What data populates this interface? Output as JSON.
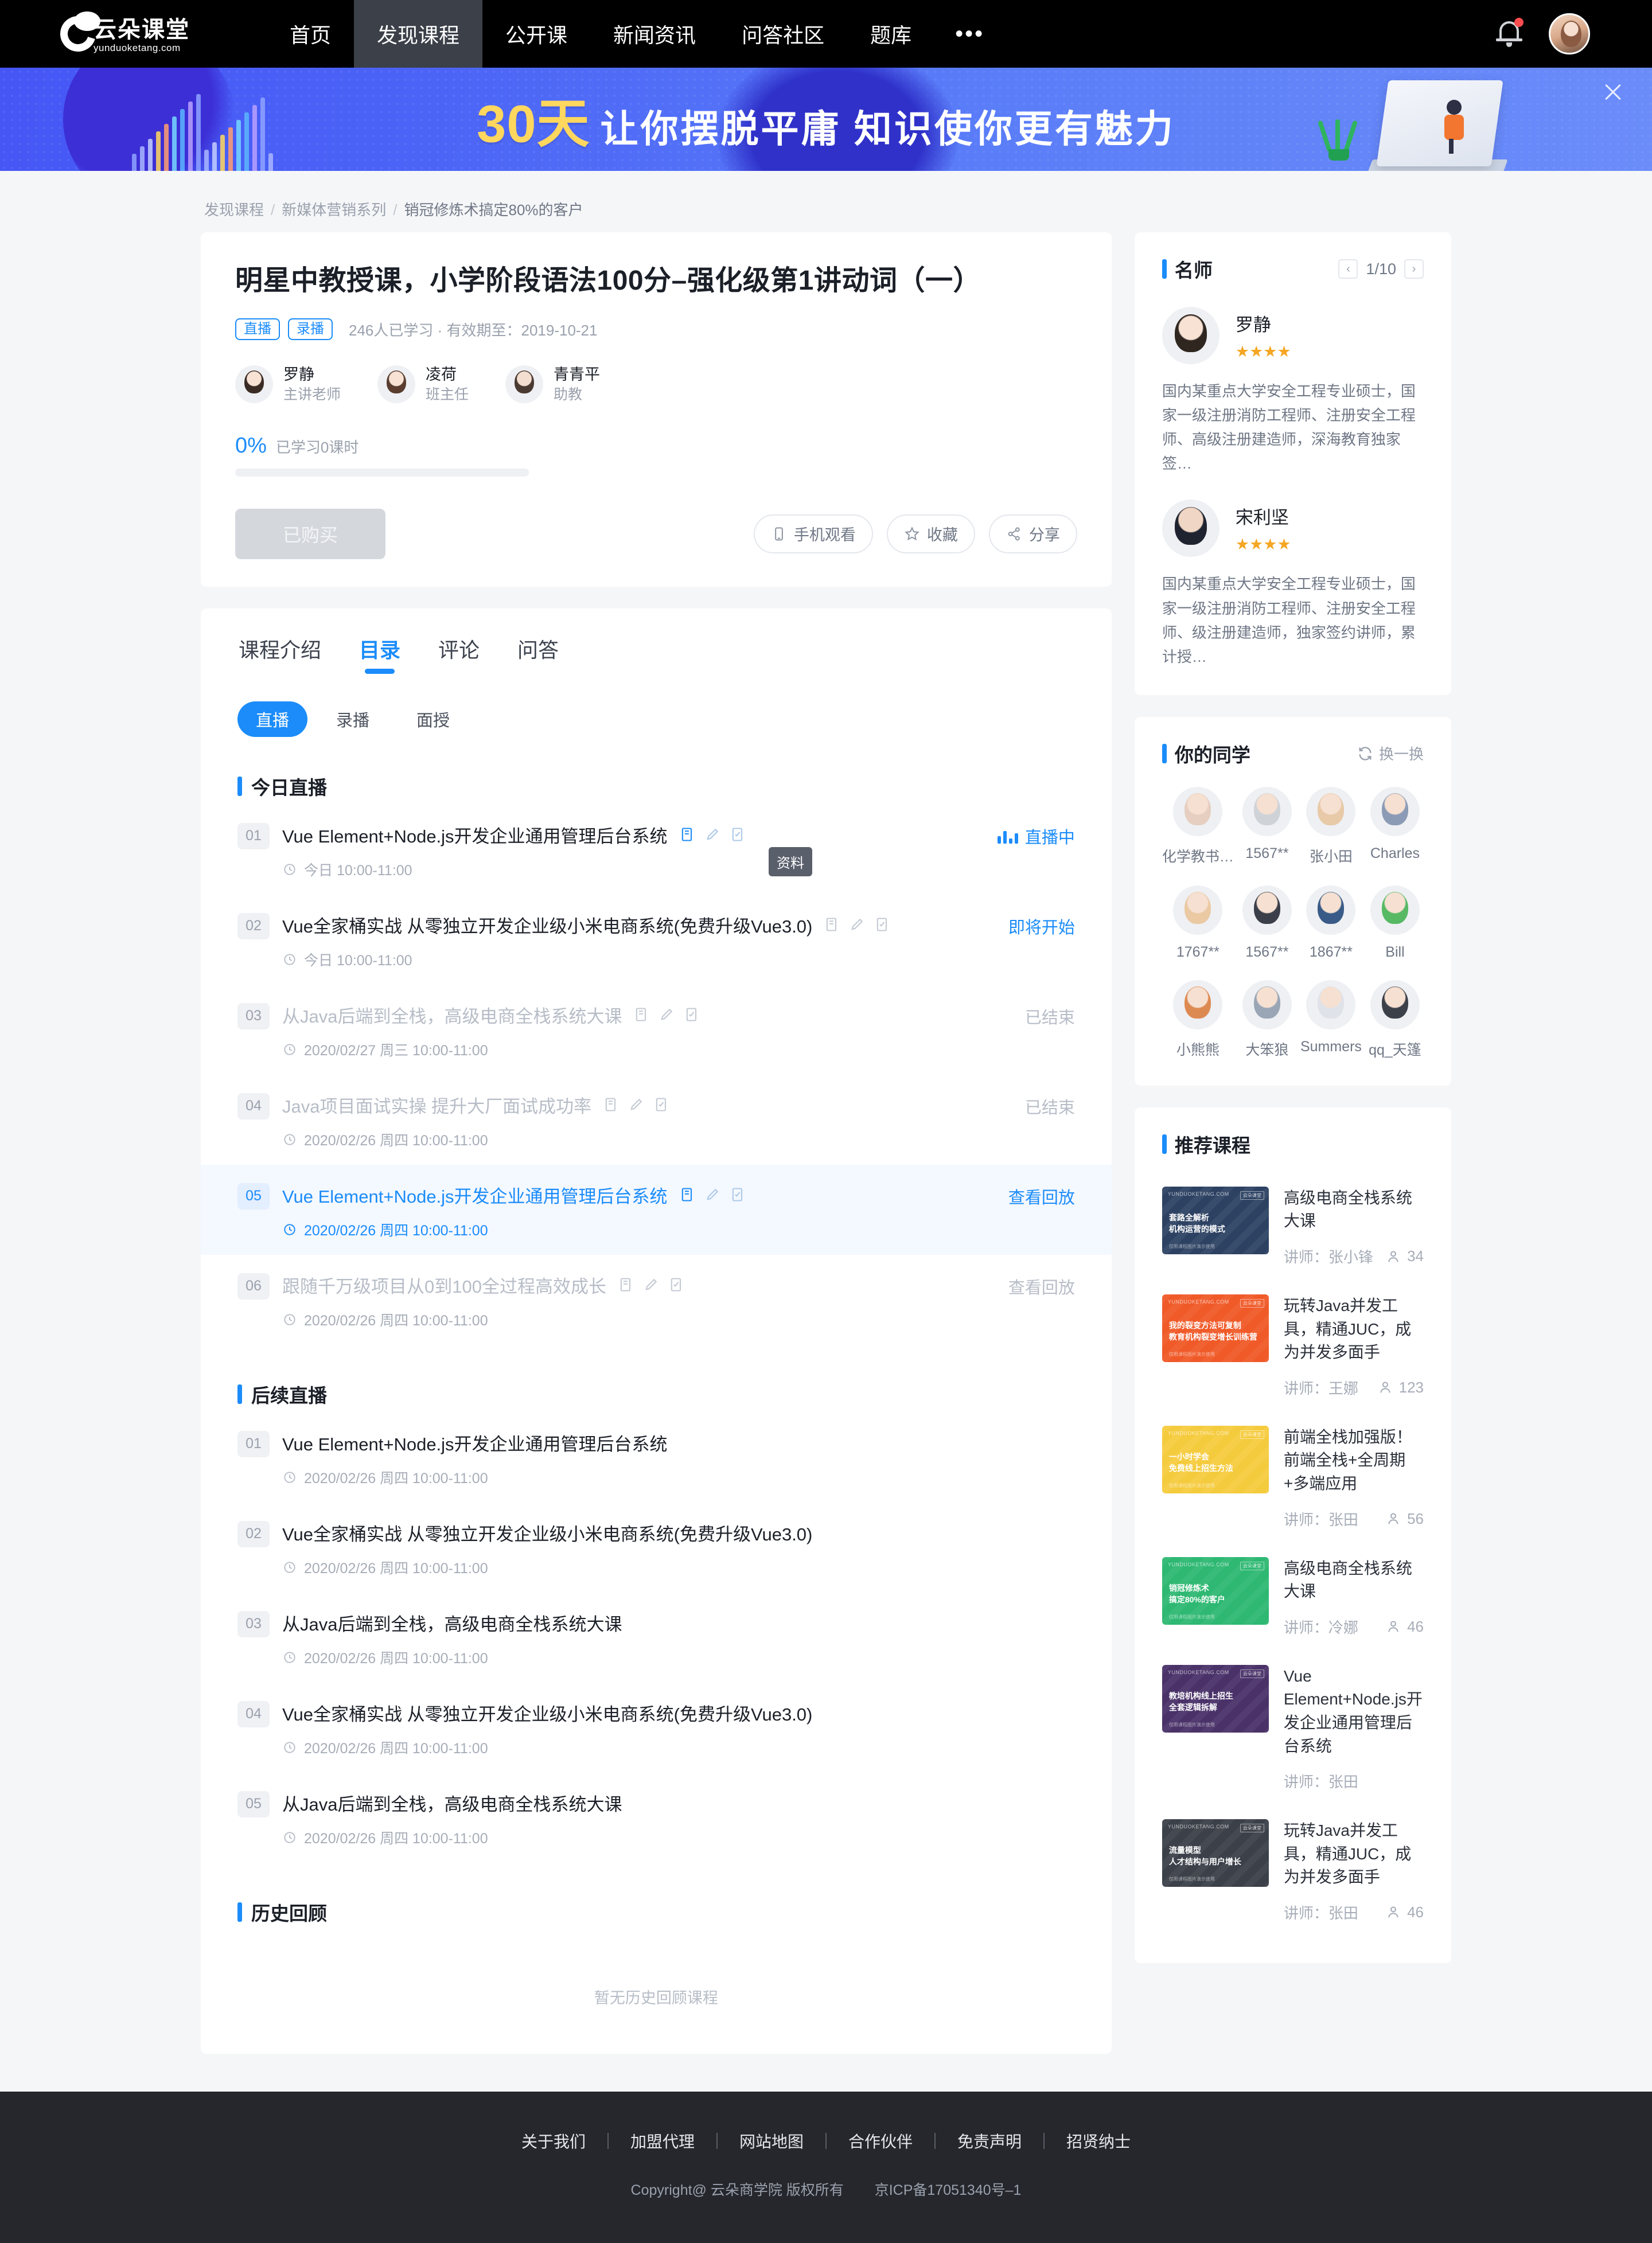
{
  "nav": {
    "logo_text": "云朵课堂",
    "logo_sub": "yunduoketang.com",
    "items": [
      {
        "label": "首页",
        "active": false
      },
      {
        "label": "发现课程",
        "active": true
      },
      {
        "label": "公开课",
        "active": false
      },
      {
        "label": "新闻资讯",
        "active": false
      },
      {
        "label": "问答社区",
        "active": false
      },
      {
        "label": "题库",
        "active": false
      }
    ],
    "more": "•••"
  },
  "banner": {
    "highlight": "30天",
    "text": "让你摆脱平庸  知识使你更有魅力"
  },
  "breadcrumb": {
    "items": [
      "发现课程",
      "新媒体营销系列",
      "销冠修炼术搞定80%的客户"
    ],
    "separator": "/"
  },
  "course": {
    "title": "明星中教授课，小学阶段语法100分–强化级第1讲动词（一）",
    "tags": [
      "直播",
      "录播"
    ],
    "meta": "246人已学习 · 有效期至：2019-10-21",
    "teachers": [
      {
        "name": "罗静",
        "role": "主讲老师"
      },
      {
        "name": "凌荷",
        "role": "班主任"
      },
      {
        "name": "青青平",
        "role": "助教"
      }
    ],
    "progress_pct": "0%",
    "progress_label": "已学习0课时",
    "progress_value": 0,
    "buy_button": "已购买",
    "actions": [
      {
        "label": "手机观看",
        "icon": "phone-icon"
      },
      {
        "label": "收藏",
        "icon": "star-icon"
      },
      {
        "label": "分享",
        "icon": "share-icon"
      }
    ]
  },
  "catalog": {
    "tabs": [
      {
        "label": "课程介绍",
        "active": false
      },
      {
        "label": "目录",
        "active": true
      },
      {
        "label": "评论",
        "active": false
      },
      {
        "label": "问答",
        "active": false
      }
    ],
    "subtabs": [
      {
        "label": "直播",
        "active": true
      },
      {
        "label": "录播",
        "active": false
      },
      {
        "label": "面授",
        "active": false
      }
    ],
    "tooltip": "资料",
    "sections": [
      {
        "title": "今日直播",
        "lessons": [
          {
            "num": "01",
            "title": "Vue Element+Node.js开发企业通用管理后台系统",
            "time": "今日 10:00-11:00",
            "status": "直播中",
            "status_type": "live",
            "icons": true,
            "state": "normal"
          },
          {
            "num": "02",
            "title": "Vue全家桶实战 从零独立开发企业级小米电商系统(免费升级Vue3.0)",
            "time": "今日 10:00-11:00",
            "status": "即将开始",
            "status_type": "soon",
            "icons": true,
            "state": "normal"
          },
          {
            "num": "03",
            "title": "从Java后端到全栈，高级电商全栈系统大课",
            "time": "2020/02/27 周三 10:00-11:00",
            "status": "已结束",
            "status_type": "done",
            "icons": true,
            "state": "dim"
          },
          {
            "num": "04",
            "title": "Java项目面试实操 提升大厂面试成功率",
            "time": "2020/02/26 周四 10:00-11:00",
            "status": "已结束",
            "status_type": "done",
            "icons": true,
            "state": "dim"
          },
          {
            "num": "05",
            "title": "Vue Element+Node.js开发企业通用管理后台系统",
            "time": "2020/02/26 周四 10:00-11:00",
            "status": "查看回放",
            "status_type": "replay",
            "icons": true,
            "state": "highlight"
          },
          {
            "num": "06",
            "title": "跟随千万级项目从0到100全过程高效成长",
            "time": "2020/02/26 周四 10:00-11:00",
            "status": "查看回放",
            "status_type": "replay-dim",
            "icons": true,
            "state": "dim"
          }
        ]
      },
      {
        "title": "后续直播",
        "lessons": [
          {
            "num": "01",
            "title": "Vue Element+Node.js开发企业通用管理后台系统",
            "time": "2020/02/26 周四 10:00-11:00",
            "status": "",
            "status_type": "none",
            "icons": false,
            "state": "normal"
          },
          {
            "num": "02",
            "title": "Vue全家桶实战 从零独立开发企业级小米电商系统(免费升级Vue3.0)",
            "time": "2020/02/26 周四 10:00-11:00",
            "status": "",
            "status_type": "none",
            "icons": false,
            "state": "normal"
          },
          {
            "num": "03",
            "title": "从Java后端到全栈，高级电商全栈系统大课",
            "time": "2020/02/26 周四 10:00-11:00",
            "status": "",
            "status_type": "none",
            "icons": false,
            "state": "normal"
          },
          {
            "num": "04",
            "title": "Vue全家桶实战 从零独立开发企业级小米电商系统(免费升级Vue3.0)",
            "time": "2020/02/26 周四 10:00-11:00",
            "status": "",
            "status_type": "none",
            "icons": false,
            "state": "normal"
          },
          {
            "num": "05",
            "title": "从Java后端到全栈，高级电商全栈系统大课",
            "time": "2020/02/26 周四 10:00-11:00",
            "status": "",
            "status_type": "none",
            "icons": false,
            "state": "normal"
          }
        ]
      },
      {
        "title": "历史回顾",
        "lessons": [],
        "empty_text": "暂无历史回顾课程"
      }
    ]
  },
  "sidebar": {
    "famous": {
      "title": "名师",
      "page": "1/10",
      "prev": "‹",
      "next": "›",
      "teachers": [
        {
          "name": "罗静",
          "stars": 4,
          "desc": "国内某重点大学安全工程专业硕士，国家一级注册消防工程师、注册安全工程师、高级注册建造师，深海教育独家签…"
        },
        {
          "name": "宋利坚",
          "stars": 4,
          "desc": "国内某重点大学安全工程专业硕士，国家一级注册消防工程师、注册安全工程师、级注册建造师，独家签约讲师，累计授…"
        }
      ]
    },
    "classmates": {
      "title": "你的同学",
      "refresh_label": "换一换",
      "people": [
        {
          "name": "化学教书…",
          "color": "#e6cfc0"
        },
        {
          "name": "1567**",
          "color": "#cfd3d8"
        },
        {
          "name": "张小田",
          "color": "#e8c9a8"
        },
        {
          "name": "Charles",
          "color": "#8c9bb5"
        },
        {
          "name": "1767**",
          "color": "#eac9a3"
        },
        {
          "name": "1567**",
          "color": "#3b3f49"
        },
        {
          "name": "1867**",
          "color": "#3a5b88"
        },
        {
          "name": "Bill",
          "color": "#57b964"
        },
        {
          "name": "小熊熊",
          "color": "#dd8a52"
        },
        {
          "name": "大笨狼",
          "color": "#9aa6b6"
        },
        {
          "name": "Summers",
          "color": "#dfe2e8"
        },
        {
          "name": "qq_天篷",
          "color": "#3c4049"
        }
      ]
    },
    "recommend": {
      "title": "推荐课程",
      "courses": [
        {
          "title": "高级电商全栈系统大课",
          "teacher_label": "讲师：",
          "teacher": "张小锋",
          "count": "34",
          "thumb_color": "#2d4263",
          "thumb_line1": "套路全解析",
          "thumb_line2": "机构运营的模式",
          "thumb_brand": "YUNDUOKETANG.COM",
          "thumb_badge": "云朵课堂",
          "thumb_foot": "仅限课程图片演示使用"
        },
        {
          "title": "玩转Java并发工具，精通JUC，成为并发多面手",
          "teacher_label": "讲师：",
          "teacher": "王娜",
          "count": "123",
          "thumb_color": "#f05a28",
          "thumb_line1": "我的裂变方法可复制",
          "thumb_line2": "教育机构裂变增长训练营",
          "thumb_brand": "YUNDUOKETANG.COM",
          "thumb_badge": "云朵课堂",
          "thumb_foot": "仅限课程图片演示使用"
        },
        {
          "title": "前端全栈加强版！前端全栈+全周期+多端应用",
          "teacher_label": "讲师：",
          "teacher": "张田",
          "count": "56",
          "thumb_color": "#f5cb3e",
          "thumb_line1": "一小时学会",
          "thumb_line2": "免费线上招生方法",
          "thumb_brand": "YUNDUOKETANG.COM",
          "thumb_badge": "云朵课堂",
          "thumb_foot": "仅限课程图片演示使用"
        },
        {
          "title": "高级电商全栈系统大课",
          "teacher_label": "讲师：",
          "teacher": "冷娜",
          "count": "46",
          "thumb_color": "#2eb872",
          "thumb_line1": "销冠修炼术",
          "thumb_line2": "搞定80%的客户",
          "thumb_brand": "YUNDUOKETANG.COM",
          "thumb_badge": "云朵课堂",
          "thumb_foot": "仅限课程图片演示使用"
        },
        {
          "title": "Vue Element+Node.js开发企业通用管理后台系统",
          "teacher_label": "讲师：",
          "teacher": "张田",
          "count": "",
          "thumb_color": "#4a3269",
          "thumb_line1": "教培机构线上招生",
          "thumb_line2": "全套逻辑拆解",
          "thumb_brand": "YUNDUOKETANG.COM",
          "thumb_badge": "云朵课堂",
          "thumb_foot": "仅限课程图片演示使用"
        },
        {
          "title": "玩转Java并发工具，精通JUC，成为并发多面手",
          "teacher_label": "讲师：",
          "teacher": "张田",
          "count": "46",
          "thumb_color": "#3b4049",
          "thumb_line1": "流量模型",
          "thumb_line2": "人才结构与用户增长",
          "thumb_brand": "YUNDUOKETANG.COM",
          "thumb_badge": "云朵课堂",
          "thumb_foot": "仅限课程图片演示使用"
        }
      ]
    }
  },
  "footer": {
    "links": [
      "关于我们",
      "加盟代理",
      "网站地图",
      "合作伙伴",
      "免责声明",
      "招贤纳士"
    ],
    "copyright": "Copyright@ 云朵商学院   版权所有",
    "icp": "京ICP备17051340号–1"
  },
  "colors": {
    "accent": "#1b8cfa",
    "banner_bg": "#4b63f6",
    "nav_bg": "#000000",
    "footer_bg": "#25272c",
    "star": "#f5a623"
  }
}
